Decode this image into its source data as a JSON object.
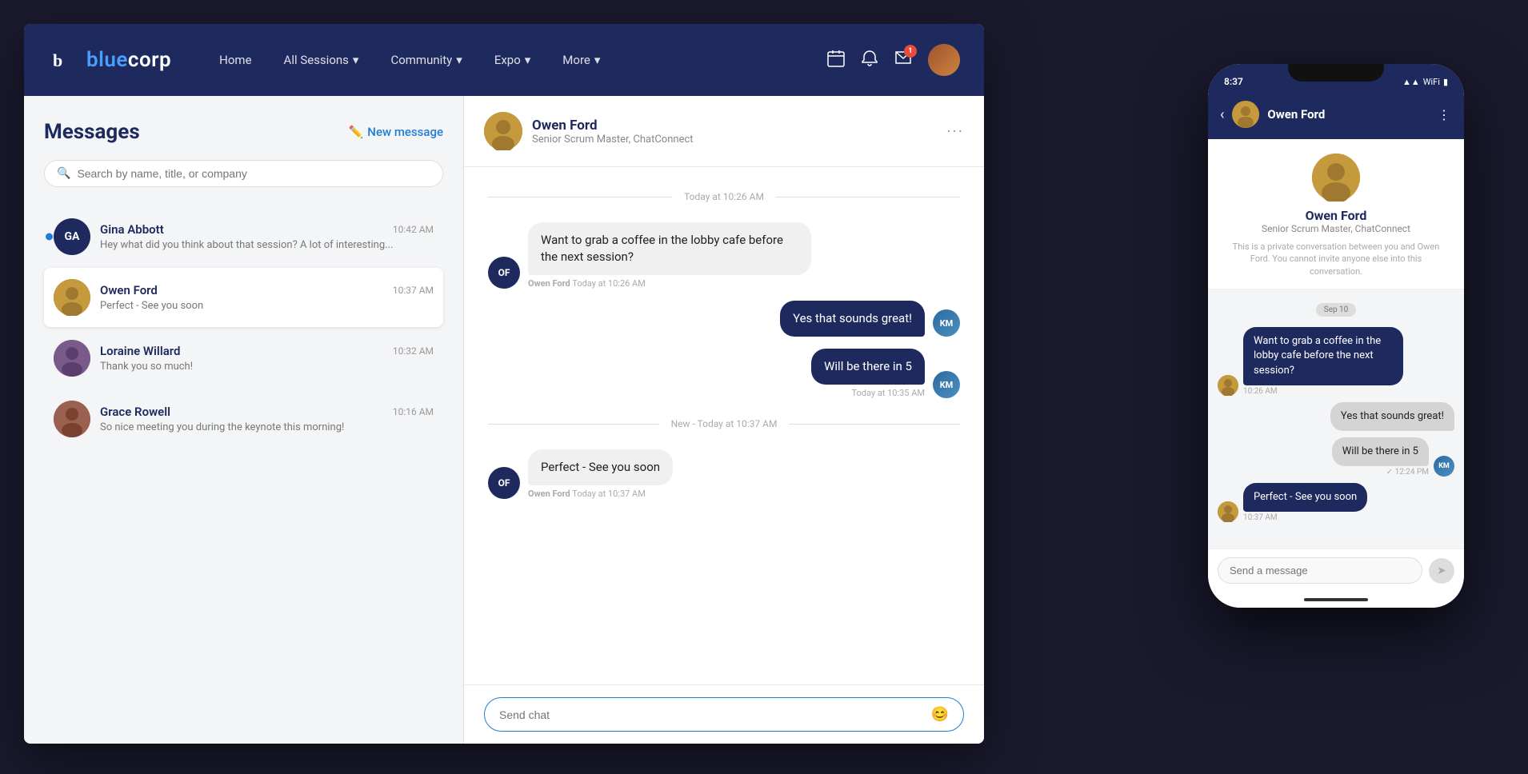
{
  "app": {
    "logo_letter": "b",
    "logo_name_prefix": "lue",
    "logo_name_suffix": "corp"
  },
  "header": {
    "nav": [
      {
        "label": "Home",
        "key": "home"
      },
      {
        "label": "All Sessions",
        "key": "all-sessions",
        "has_dropdown": true
      },
      {
        "label": "Community",
        "key": "community",
        "has_dropdown": true
      },
      {
        "label": "Expo",
        "key": "expo",
        "has_dropdown": true
      },
      {
        "label": "More",
        "key": "more",
        "has_dropdown": true
      }
    ],
    "notification_badge": "1",
    "calendar_icon": "📅",
    "bell_icon": "🔔",
    "chat_icon": "💬"
  },
  "messages_panel": {
    "title": "Messages",
    "new_message_label": "New message",
    "search_placeholder": "Search by name, title, or company",
    "conversations": [
      {
        "id": "gina-abbott",
        "name": "Gina Abbott",
        "initials": "GA",
        "time": "10:42 AM",
        "preview": "Hey what did you think about that session? A lot of interesting...",
        "unread": true,
        "avatar_type": "initials"
      },
      {
        "id": "owen-ford",
        "name": "Owen Ford",
        "time": "10:37 AM",
        "preview": "Perfect - See you soon",
        "unread": false,
        "avatar_type": "photo",
        "active": true
      },
      {
        "id": "loraine-willard",
        "name": "Loraine Willard",
        "time": "10:32 AM",
        "preview": "Thank you so much!",
        "unread": false,
        "avatar_type": "photo"
      },
      {
        "id": "grace-rowell",
        "name": "Grace Rowell",
        "time": "10:16 AM",
        "preview": "So nice meeting you during the keynote this morning!",
        "unread": false,
        "avatar_type": "photo"
      }
    ]
  },
  "chat": {
    "contact_name": "Owen Ford",
    "contact_subtitle": "Senior Scrum Master, ChatConnect",
    "date_divider": "Today at 10:26 AM",
    "new_divider": "New - Today at 10:37 AM",
    "messages": [
      {
        "id": "msg1",
        "direction": "incoming",
        "text": "Want to grab a coffee in the lobby cafe before the next session?",
        "sender": "Owen Ford",
        "time": "Today at 10:26 AM",
        "avatar": "OF"
      },
      {
        "id": "msg2",
        "direction": "outgoing",
        "text": "Yes that sounds great!",
        "time": "Today at 10:35 AM",
        "avatar": "KM"
      },
      {
        "id": "msg3",
        "direction": "outgoing",
        "text": "Will be there in 5",
        "time": "Today at 10:35 AM",
        "avatar": "KM"
      },
      {
        "id": "msg4",
        "direction": "incoming",
        "text": "Perfect - See you soon",
        "sender": "Owen Ford",
        "time": "Today at 10:37 AM",
        "avatar": "OF"
      }
    ],
    "input_placeholder": "Send chat"
  },
  "phone": {
    "time": "8:37",
    "contact_name": "Owen Ford",
    "contact_subtitle": "Senior Scrum Master, ChatConnect",
    "private_note": "This is a private conversation between you and Owen Ford. You cannot invite anyone else into this conversation.",
    "date_badge": "Sep 10",
    "messages": [
      {
        "direction": "incoming",
        "text": "Want to grab a coffee in the lobby cafe before the next session?",
        "time": "10:26 AM"
      },
      {
        "direction": "outgoing",
        "text": "Yes that sounds great!",
        "time": ""
      },
      {
        "direction": "outgoing",
        "text": "Will be there in 5",
        "time": "✓ 12:24 PM"
      },
      {
        "direction": "incoming",
        "text": "Perfect - See you soon",
        "time": "10:37 AM"
      }
    ],
    "input_placeholder": "Send a message"
  }
}
